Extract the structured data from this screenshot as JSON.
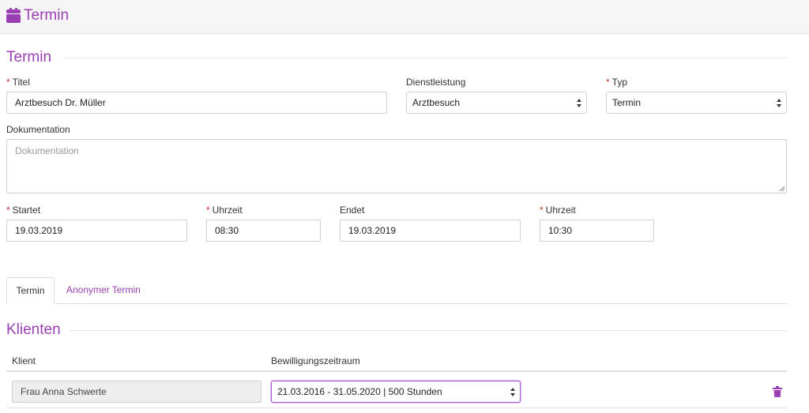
{
  "header": {
    "title": "Termin"
  },
  "form": {
    "section_title": "Termin",
    "required_mark": "*",
    "titel": {
      "label": "Titel",
      "value": "Arztbesuch Dr. Müller"
    },
    "dienstleistung": {
      "label": "Dienstleistung",
      "value": "Arztbesuch"
    },
    "typ": {
      "label": "Typ",
      "value": "Termin"
    },
    "dokumentation": {
      "label": "Dokumentation",
      "placeholder": "Dokumentation"
    },
    "startet": {
      "label": "Startet",
      "value": "19.03.2019"
    },
    "start_uhrzeit": {
      "label": "Uhrzeit",
      "value": "08:30"
    },
    "endet": {
      "label": "Endet",
      "value": "19.03.2019"
    },
    "end_uhrzeit": {
      "label": "Uhrzeit",
      "value": "10:30"
    }
  },
  "tabs": [
    {
      "label": "Termin",
      "active": true
    },
    {
      "label": "Anonymer Termin",
      "active": false
    }
  ],
  "klienten": {
    "section_title": "Klienten",
    "columns": [
      "Klient",
      "Bewilligungszeitraum"
    ],
    "rows": [
      {
        "klient": "Frau Anna Schwerte",
        "zeitraum": "21.03.2016 - 31.05.2020 | 500 Stunden"
      }
    ]
  },
  "colors": {
    "accent": "#9b3fb5",
    "required": "#c0392b",
    "focus": "#a65bd0"
  },
  "icons": {
    "header": "calendar-icon",
    "delete": "trash-icon",
    "select": "updown-arrows-icon",
    "resize": "resize-grip-icon"
  }
}
